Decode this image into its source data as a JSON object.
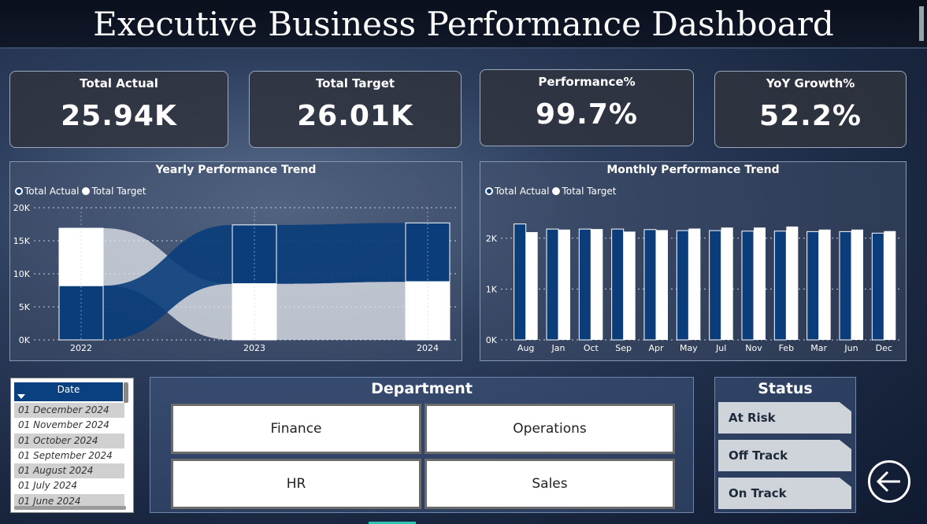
{
  "header": {
    "title": "Executive Business Performance Dashboard"
  },
  "kpis": [
    {
      "label": "Total Actual",
      "value": "25.94K"
    },
    {
      "label": "Total Target",
      "value": "26.01K"
    },
    {
      "label": "Performance%",
      "value": "99.7%"
    },
    {
      "label": "YoY Growth%",
      "value": "52.2%"
    }
  ],
  "legend": {
    "actual": "Total Actual",
    "target": "Total Target"
  },
  "colors": {
    "actual": "#0a3d7a",
    "target": "#ffffff"
  },
  "chart_data": [
    {
      "type": "bar",
      "subtype": "ribbon-stacked",
      "title": "Yearly Performance Trend",
      "categories": [
        "2022",
        "2023",
        "2024"
      ],
      "series": [
        {
          "name": "Total Actual",
          "values": [
            8200,
            8900,
            8900
          ]
        },
        {
          "name": "Total Target",
          "values": [
            8700,
            8500,
            8800
          ]
        }
      ],
      "yticks": [
        "0K",
        "5K",
        "10K",
        "15K",
        "20K"
      ],
      "ylim": [
        0,
        20000
      ],
      "legend": "top-left",
      "grid": true
    },
    {
      "type": "bar",
      "title": "Monthly Performance Trend",
      "categories": [
        "Aug",
        "Jan",
        "Oct",
        "Sep",
        "Apr",
        "May",
        "Jul",
        "Nov",
        "Feb",
        "Mar",
        "Jun",
        "Dec"
      ],
      "series": [
        {
          "name": "Total Actual",
          "values": [
            2280,
            2180,
            2180,
            2180,
            2170,
            2150,
            2150,
            2140,
            2140,
            2130,
            2130,
            2100
          ]
        },
        {
          "name": "Total Target",
          "values": [
            2120,
            2170,
            2180,
            2130,
            2160,
            2190,
            2210,
            2210,
            2230,
            2170,
            2170,
            2140
          ]
        }
      ],
      "yticks": [
        "0K",
        "1K",
        "2K"
      ],
      "ylim": [
        0,
        2600
      ],
      "legend": "top-left",
      "grid": true
    }
  ],
  "date_slicer": {
    "header": "Date",
    "items": [
      "01 December 2024",
      "01 November 2024",
      "01 October 2024",
      "01 September 2024",
      "01 August 2024",
      "01 July 2024",
      "01 June 2024"
    ]
  },
  "department": {
    "title": "Department",
    "buttons": [
      "Finance",
      "Operations",
      "HR",
      "Sales"
    ]
  },
  "status": {
    "title": "Status",
    "buttons": [
      "At Risk",
      "Off Track",
      "On Track"
    ]
  }
}
